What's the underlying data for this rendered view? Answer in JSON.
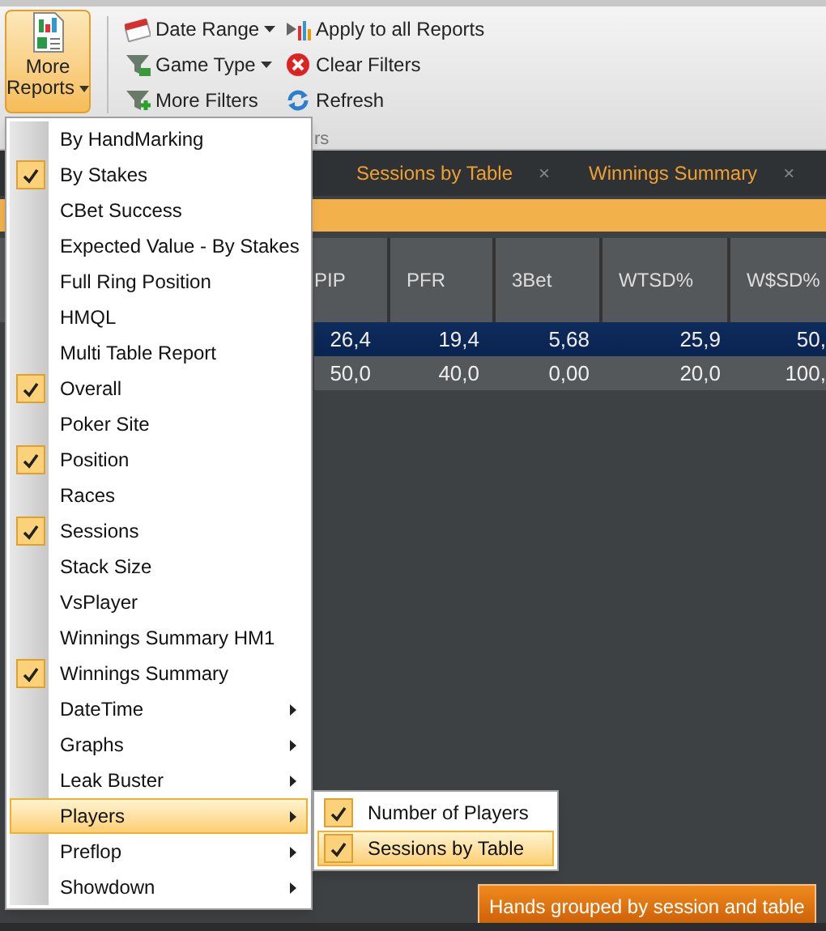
{
  "ribbon": {
    "more_reports": {
      "label": "More Reports",
      "selected": true
    },
    "filter_buttons": [
      {
        "label": "Date Range",
        "dropdown": true
      },
      {
        "label": "Game Type",
        "dropdown": true
      },
      {
        "label": "More Filters",
        "dropdown": false
      },
      {
        "label": "Apply to all Reports",
        "dropdown": false
      },
      {
        "label": "Clear Filters",
        "dropdown": false
      },
      {
        "label": "Refresh",
        "dropdown": false
      }
    ],
    "group_label": "rs"
  },
  "tabs": [
    {
      "label": "Sessions by Table",
      "close": "×"
    },
    {
      "label": "Winnings Summary",
      "close": "×"
    }
  ],
  "table": {
    "columns": [
      "PIP",
      "PFR",
      "3Bet",
      "WTSD%",
      "W$SD%"
    ],
    "rows": [
      {
        "selected": true,
        "cells": [
          "26,4",
          "19,4",
          "5,68",
          "25,9",
          "50,"
        ]
      },
      {
        "selected": false,
        "cells": [
          "50,0",
          "40,0",
          "0,00",
          "20,0",
          "100,"
        ]
      }
    ]
  },
  "menu": [
    {
      "kind": "item",
      "label": "By HandMarking",
      "checked": false,
      "selected": false
    },
    {
      "kind": "item",
      "label": "By Stakes",
      "checked": true,
      "selected": false
    },
    {
      "kind": "item",
      "label": "CBet Success",
      "checked": false,
      "selected": false
    },
    {
      "kind": "item",
      "label": "Expected Value - By Stakes",
      "checked": false,
      "selected": false
    },
    {
      "kind": "item",
      "label": "Full Ring Position",
      "checked": false,
      "selected": false
    },
    {
      "kind": "item",
      "label": "HMQL",
      "checked": false,
      "selected": false
    },
    {
      "kind": "item",
      "label": "Multi Table Report",
      "checked": false,
      "selected": false
    },
    {
      "kind": "item",
      "label": "Overall",
      "checked": true,
      "selected": false
    },
    {
      "kind": "item",
      "label": "Poker Site",
      "checked": false,
      "selected": false
    },
    {
      "kind": "item",
      "label": "Position",
      "checked": true,
      "selected": false
    },
    {
      "kind": "item",
      "label": "Races",
      "checked": false,
      "selected": false
    },
    {
      "kind": "item",
      "label": "Sessions",
      "checked": true,
      "selected": false
    },
    {
      "kind": "item",
      "label": "Stack Size",
      "checked": false,
      "selected": false
    },
    {
      "kind": "item",
      "label": "VsPlayer",
      "checked": false,
      "selected": false
    },
    {
      "kind": "item",
      "label": "Winnings Summary HM1",
      "checked": false,
      "selected": false
    },
    {
      "kind": "item",
      "label": "Winnings Summary",
      "checked": true,
      "selected": false
    },
    {
      "kind": "submenu",
      "label": "DateTime",
      "checked": false,
      "selected": false
    },
    {
      "kind": "submenu",
      "label": "Graphs",
      "checked": false,
      "selected": false
    },
    {
      "kind": "submenu",
      "label": "Leak Buster",
      "checked": false,
      "selected": false
    },
    {
      "kind": "submenu",
      "label": "Players",
      "checked": false,
      "selected": true
    },
    {
      "kind": "submenu",
      "label": "Preflop",
      "checked": false,
      "selected": false
    },
    {
      "kind": "submenu",
      "label": "Showdown",
      "checked": false,
      "selected": false
    }
  ],
  "submenu": [
    {
      "label": "Number of Players",
      "checked": true,
      "selected": false
    },
    {
      "label": "Sessions by Table",
      "checked": true,
      "selected": true
    }
  ],
  "tooltip": "Hands grouped by session and table"
}
